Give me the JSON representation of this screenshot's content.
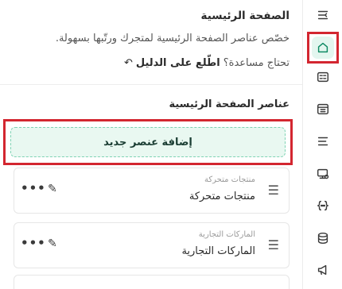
{
  "header": {
    "title": "الصفحة الرئيسية",
    "description": "خصّص عناصر الصفحة الرئيسية لمتجرك ورتّبها بسهولة.",
    "help_prompt": "تحتاج مساعدة؟",
    "help_link": "اطّلع على الدليل"
  },
  "section": {
    "title": "عناصر الصفحة الرئيسية",
    "add_button_label": "إضافة عنصر جديد"
  },
  "items": [
    {
      "subtitle": "منتجات متحركة",
      "name": "منتجات متحركة"
    },
    {
      "subtitle": "الماركات التجارية",
      "name": "الماركات التجارية"
    }
  ],
  "icons": {
    "menu": "collapse-menu-icon",
    "home": "home-icon",
    "layout": "layout-icon",
    "calendar": "calendar-icon",
    "lines": "list-icon",
    "monitor": "monitor-icon",
    "code": "code-icon",
    "database": "database-icon",
    "megaphone": "megaphone-icon",
    "drag": "drag-handle-icon",
    "edit": "edit-icon",
    "more": "more-icon"
  },
  "colors": {
    "accent": "#0e8a63",
    "accent_bg": "#e9f8f1",
    "highlight": "#d32630"
  }
}
